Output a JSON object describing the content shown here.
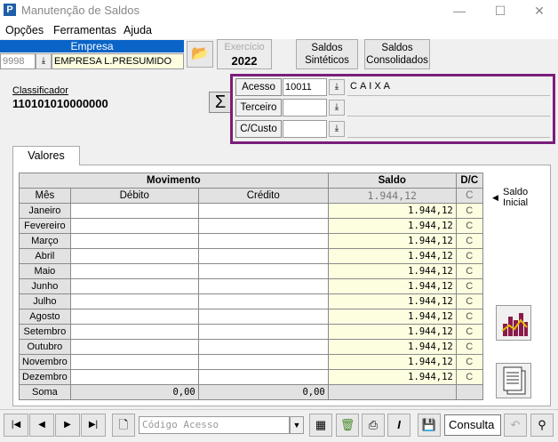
{
  "window": {
    "title": "Manutenção de Saldos",
    "minimize": "—",
    "maximize": "☐",
    "close": "✕"
  },
  "menu": [
    "Opções",
    "Ferramentas",
    "Ajuda"
  ],
  "empresa": {
    "header": "Empresa",
    "code": "9998",
    "name": "EMPRESA L.PRESUMIDO"
  },
  "exercicio": {
    "label": "Exercício",
    "value": "2022"
  },
  "buttons": {
    "saldos_sinteticos_1": "Saldos",
    "saldos_sinteticos_2": "Sintéticos",
    "saldos_consolidados_1": "Saldos",
    "saldos_consolidados_2": "Consolidados"
  },
  "classificador": {
    "label": "Classificador",
    "value": "110101010000000"
  },
  "acesso": {
    "acesso_label": "Acesso",
    "acesso_value": "10011",
    "acesso_desc": "CAIXA",
    "terceiro_label": "Terceiro",
    "terceiro_value": "",
    "custo_label": "C/Custo",
    "custo_value": ""
  },
  "tab": {
    "label": "Valores"
  },
  "table": {
    "movimento": "Movimento",
    "saldo": "Saldo",
    "dc": "D/C",
    "mes": "Mês",
    "debito": "Débito",
    "credito": "Crédito",
    "saldo_inicial_value": "1.944,12",
    "saldo_inicial_dc": "C",
    "rows": [
      {
        "mes": "Janeiro",
        "debito": "",
        "credito": "",
        "saldo": "1.944,12",
        "dc": "C"
      },
      {
        "mes": "Fevereiro",
        "debito": "",
        "credito": "",
        "saldo": "1.944,12",
        "dc": "C"
      },
      {
        "mes": "Março",
        "debito": "",
        "credito": "",
        "saldo": "1.944,12",
        "dc": "C"
      },
      {
        "mes": "Abril",
        "debito": "",
        "credito": "",
        "saldo": "1.944,12",
        "dc": "C"
      },
      {
        "mes": "Maio",
        "debito": "",
        "credito": "",
        "saldo": "1.944,12",
        "dc": "C"
      },
      {
        "mes": "Junho",
        "debito": "",
        "credito": "",
        "saldo": "1.944,12",
        "dc": "C"
      },
      {
        "mes": "Julho",
        "debito": "",
        "credito": "",
        "saldo": "1.944,12",
        "dc": "C"
      },
      {
        "mes": "Agosto",
        "debito": "",
        "credito": "",
        "saldo": "1.944,12",
        "dc": "C"
      },
      {
        "mes": "Setembro",
        "debito": "",
        "credito": "",
        "saldo": "1.944,12",
        "dc": "C"
      },
      {
        "mes": "Outubro",
        "debito": "",
        "credito": "",
        "saldo": "1.944,12",
        "dc": "C"
      },
      {
        "mes": "Novembro",
        "debito": "",
        "credito": "",
        "saldo": "1.944,12",
        "dc": "C"
      },
      {
        "mes": "Dezembro",
        "debito": "",
        "credito": "",
        "saldo": "1.944,12",
        "dc": "C"
      }
    ],
    "soma_label": "Soma",
    "soma_debito": "0,00",
    "soma_credito": "0,00"
  },
  "saldo_inicial_label_1": "Saldo",
  "saldo_inicial_label_2": "Inicial",
  "bottom": {
    "codigo_placeholder": "Código Acesso",
    "mode": "Consulta"
  }
}
